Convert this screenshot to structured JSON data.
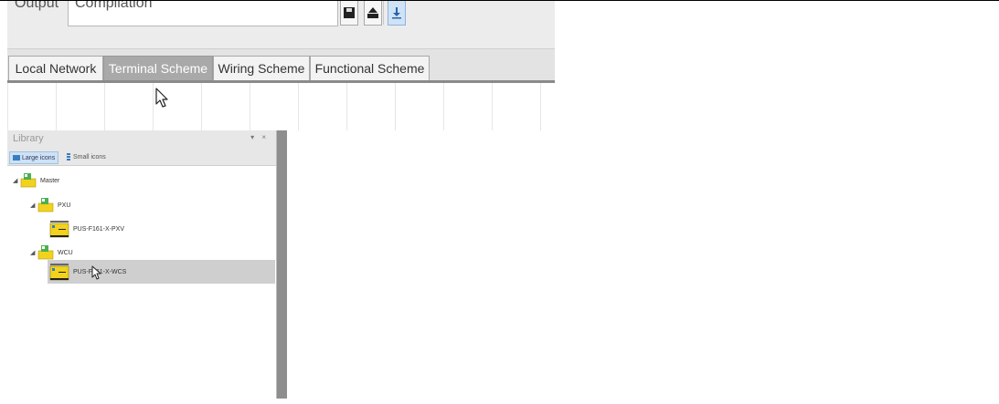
{
  "output": {
    "label": "Output",
    "value": "Compilation"
  },
  "tabs": [
    {
      "label": "Local Network",
      "active": false
    },
    {
      "label": "Terminal Scheme",
      "active": true
    },
    {
      "label": "Wiring Scheme",
      "active": false
    },
    {
      "label": "Functional Scheme",
      "active": false
    }
  ],
  "library": {
    "title": "Library",
    "controls": "▾ ×",
    "view_options": {
      "large_icons": "Large icons",
      "small_icons": "Small icons"
    },
    "tree": [
      {
        "label": "Master",
        "level": 0,
        "expander": "◢",
        "icon": "folder-icon"
      },
      {
        "label": "PXU",
        "level": 1,
        "expander": "◢",
        "icon": "folder-icon"
      },
      {
        "label": "PUS-F161-X-PXV",
        "level": 2,
        "icon": "device-icon"
      },
      {
        "label": "WCU",
        "level": 1,
        "expander": "◢",
        "icon": "folder-icon"
      },
      {
        "label": "PUS-F161-X-WCS",
        "level": 2,
        "icon": "device-icon",
        "selected": true
      }
    ]
  },
  "colors": {
    "active_tab": "#a9a9a9",
    "selected_row": "#cfcfcf",
    "splitter": "#8e8e8e",
    "folder_yellow": "#f2d21b",
    "folder_green": "#4caf50"
  }
}
